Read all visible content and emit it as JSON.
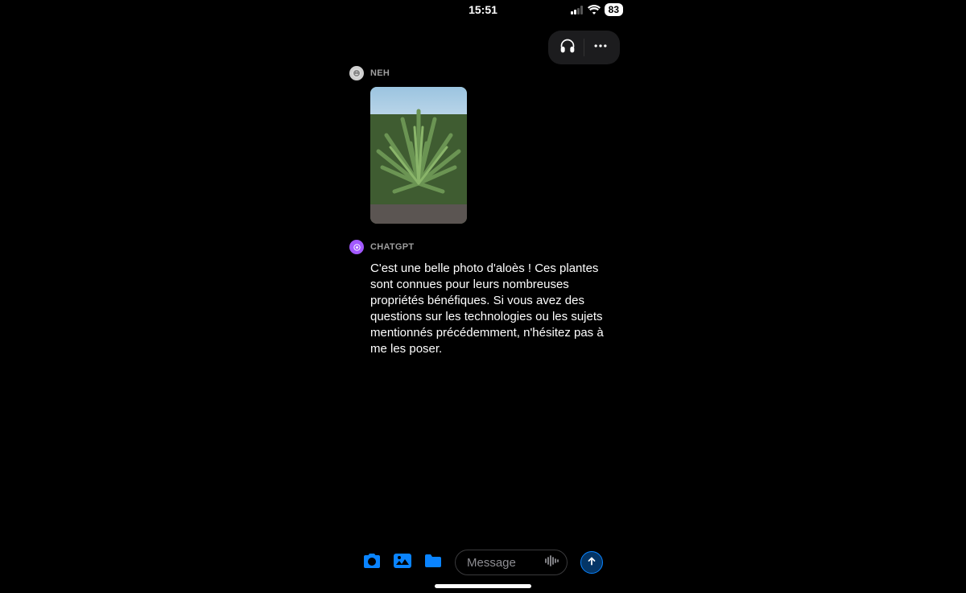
{
  "status_bar": {
    "time": "15:51",
    "battery_percent": "83"
  },
  "top_actions": {
    "headphones_label": "headphones",
    "more_label": "more"
  },
  "conversation": {
    "user": {
      "name": "NEH",
      "attachment_alt": "aloe-plant-photo"
    },
    "bot": {
      "name": "CHATGPT",
      "text": "C'est une belle photo d'aloès ! Ces plantes sont connues pour leurs nombreuses propriétés bénéfiques. Si vous avez des questions sur les technologies ou les sujets mentionnés précédemment, n'hésitez pas à me les poser."
    }
  },
  "composer": {
    "placeholder": "Message"
  },
  "colors": {
    "accent_blue": "#0A84FF",
    "bot_violet": "#A259FF",
    "bg_pill": "#1C1C1E"
  }
}
